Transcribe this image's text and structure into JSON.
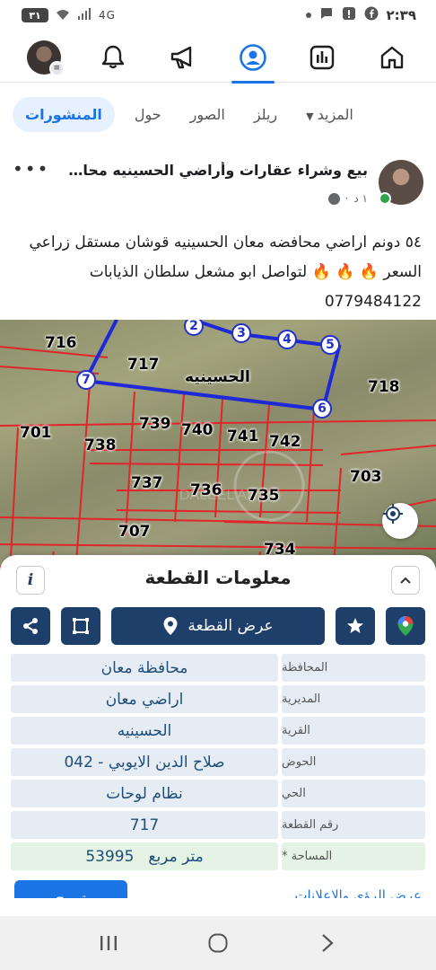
{
  "status_bar": {
    "time": "٢:٣٩",
    "battery": "٣١",
    "signal": "4G"
  },
  "top_nav": {
    "icons": [
      "home-icon",
      "dashboard-icon",
      "profile-icon",
      "megaphone-icon",
      "bell-icon",
      "menu-avatar"
    ],
    "active": "profile-icon",
    "accent": "#1b74e4"
  },
  "tabs": [
    {
      "label": "المنشورات",
      "active": true
    },
    {
      "label": "حول"
    },
    {
      "label": "الصور"
    },
    {
      "label": "ريلز"
    },
    {
      "label": "المزيد"
    }
  ],
  "post": {
    "title": "بيع وشراء عقارات وأراضي الحسينيه محافظة...",
    "time": "١ د",
    "line1": "٥٤ دونم اراضي محافضه معان الحسينيه قوشان مستقل  زراعي",
    "line2_a": "السعر",
    "line2_b": "لتواصل ابو مشعل سلطان الذيابات",
    "fire": "🔥",
    "phone": "0779484122"
  },
  "map": {
    "village": "الحسينيه",
    "parcels": [
      "716",
      "717",
      "718",
      "701",
      "738",
      "739",
      "740",
      "741",
      "742",
      "737",
      "736",
      "735",
      "703",
      "707",
      "734"
    ],
    "vertices": [
      "2",
      "3",
      "4",
      "5",
      "6",
      "7"
    ],
    "watermark": "DALEEL ARD"
  },
  "panel": {
    "title": "معلومات القطعة",
    "show_button": "عرض القطعة",
    "rows": [
      {
        "label": "المحافظة",
        "value": "محافظة معان"
      },
      {
        "label": "المديرية",
        "value": "اراضي معان"
      },
      {
        "label": "القرية",
        "value": "الحسينيه"
      },
      {
        "label": "الحوض",
        "value": "صلاح الدين الايوبي - 042"
      },
      {
        "label": "الحي",
        "value": "نظام لوحات"
      },
      {
        "label": "رقم القطعة",
        "value": "717"
      },
      {
        "label": "المساحة *",
        "value_num": "53995",
        "value_unit": "متر مربع"
      }
    ]
  },
  "footer": {
    "promote": "ترويج",
    "insights": "عرض الرؤى والإعلانات"
  }
}
